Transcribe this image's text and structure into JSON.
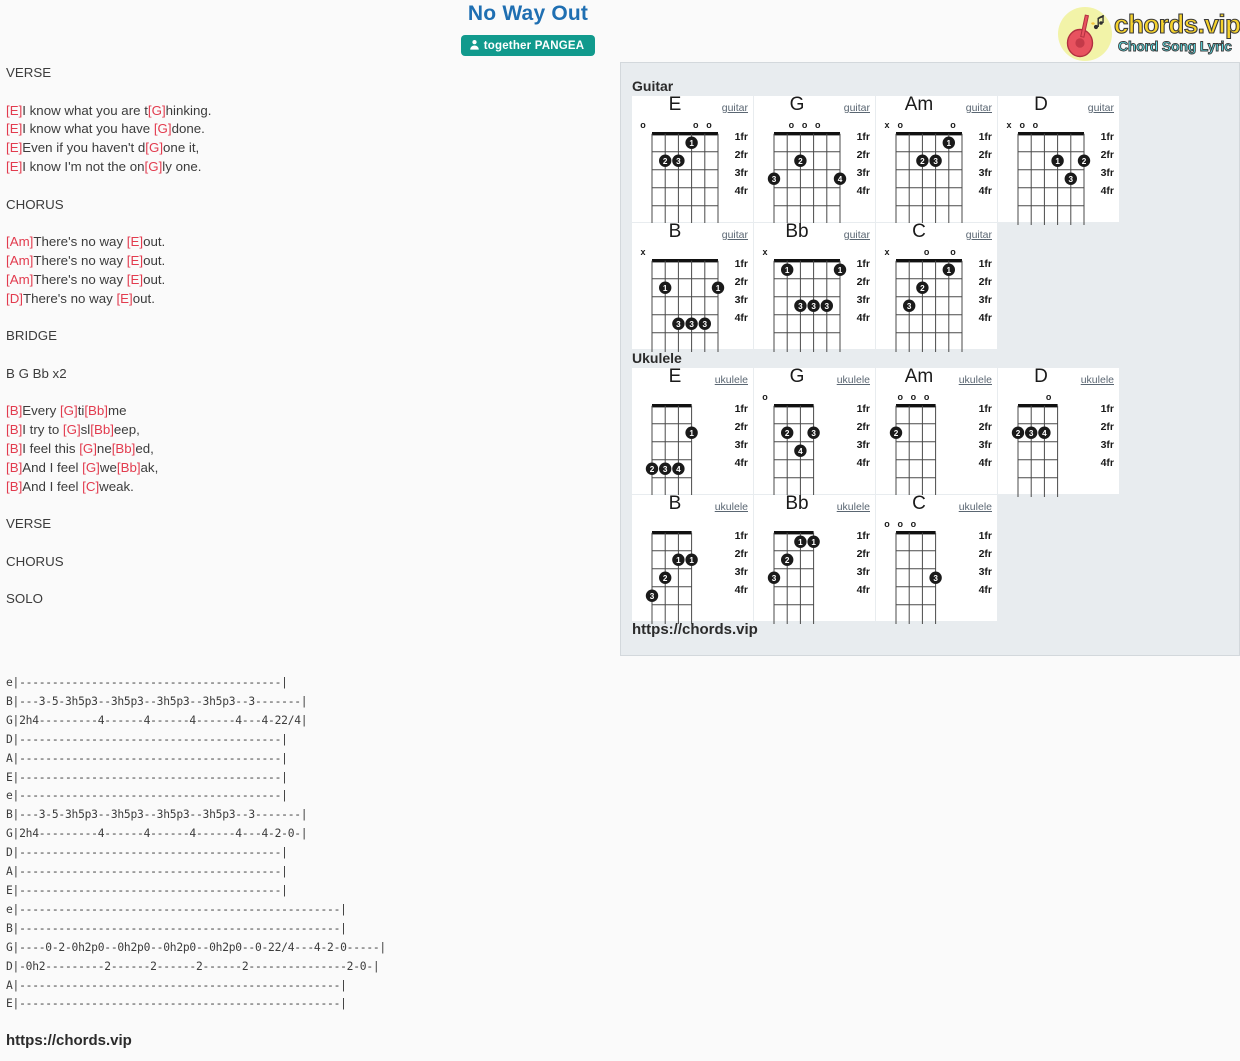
{
  "header": {
    "title": "No Way Out",
    "artist": "together PANGEA",
    "artist_icon": "user-icon",
    "logo_brand": "chords.vip",
    "logo_tagline": "Chord Song Lyric",
    "logo_icon": "guitar-logo-icon"
  },
  "lyrics": {
    "blocks": [
      {
        "type": "section",
        "text": "VERSE"
      },
      {
        "type": "blank",
        "text": ""
      },
      {
        "type": "line",
        "parts": [
          {
            "c": "[E]"
          },
          {
            "t": "I know what you are t"
          },
          {
            "c": "[G]"
          },
          {
            "t": "hinking."
          }
        ]
      },
      {
        "type": "line",
        "parts": [
          {
            "c": "[E]"
          },
          {
            "t": "I know what you have "
          },
          {
            "c": "[G]"
          },
          {
            "t": "done."
          }
        ]
      },
      {
        "type": "line",
        "parts": [
          {
            "c": "[E]"
          },
          {
            "t": "Even if you haven't d"
          },
          {
            "c": "[G]"
          },
          {
            "t": "one it,"
          }
        ]
      },
      {
        "type": "line",
        "parts": [
          {
            "c": "[E]"
          },
          {
            "t": "I know I'm not the on"
          },
          {
            "c": "[G]"
          },
          {
            "t": "ly one."
          }
        ]
      },
      {
        "type": "blank",
        "text": ""
      },
      {
        "type": "section",
        "text": "CHORUS"
      },
      {
        "type": "blank",
        "text": ""
      },
      {
        "type": "line",
        "parts": [
          {
            "c": "[Am]"
          },
          {
            "t": "There's no way "
          },
          {
            "c": "[E]"
          },
          {
            "t": "out."
          }
        ]
      },
      {
        "type": "line",
        "parts": [
          {
            "c": "[Am]"
          },
          {
            "t": "There's no way "
          },
          {
            "c": "[E]"
          },
          {
            "t": "out."
          }
        ]
      },
      {
        "type": "line",
        "parts": [
          {
            "c": "[Am]"
          },
          {
            "t": "There's no way "
          },
          {
            "c": "[E]"
          },
          {
            "t": "out."
          }
        ]
      },
      {
        "type": "line",
        "parts": [
          {
            "c": "[D]"
          },
          {
            "t": "There's no way "
          },
          {
            "c": "[E]"
          },
          {
            "t": "out."
          }
        ]
      },
      {
        "type": "blank",
        "text": ""
      },
      {
        "type": "section",
        "text": "BRIDGE"
      },
      {
        "type": "blank",
        "text": ""
      },
      {
        "type": "section",
        "text": "B G Bb x2"
      },
      {
        "type": "blank",
        "text": ""
      },
      {
        "type": "line",
        "parts": [
          {
            "c": "[B]"
          },
          {
            "t": "Every "
          },
          {
            "c": "[G]"
          },
          {
            "t": "ti"
          },
          {
            "c": "[Bb]"
          },
          {
            "t": "me"
          }
        ]
      },
      {
        "type": "line",
        "parts": [
          {
            "c": "[B]"
          },
          {
            "t": "I try to "
          },
          {
            "c": "[G]"
          },
          {
            "t": "sl"
          },
          {
            "c": "[Bb]"
          },
          {
            "t": "eep,"
          }
        ]
      },
      {
        "type": "line",
        "parts": [
          {
            "c": "[B]"
          },
          {
            "t": "I feel this "
          },
          {
            "c": "[G]"
          },
          {
            "t": "ne"
          },
          {
            "c": "[Bb]"
          },
          {
            "t": "ed,"
          }
        ]
      },
      {
        "type": "line",
        "parts": [
          {
            "c": "[B]"
          },
          {
            "t": "And I feel "
          },
          {
            "c": "[G]"
          },
          {
            "t": "we"
          },
          {
            "c": "[Bb]"
          },
          {
            "t": "ak,"
          }
        ]
      },
      {
        "type": "line",
        "parts": [
          {
            "c": "[B]"
          },
          {
            "t": "And I feel "
          },
          {
            "c": "[C]"
          },
          {
            "t": "weak."
          }
        ]
      },
      {
        "type": "blank",
        "text": ""
      },
      {
        "type": "section",
        "text": "VERSE"
      },
      {
        "type": "blank",
        "text": ""
      },
      {
        "type": "section",
        "text": "CHORUS"
      },
      {
        "type": "blank",
        "text": ""
      },
      {
        "type": "section",
        "text": "SOLO"
      }
    ]
  },
  "tab": {
    "lines": [
      "e|----------------------------------------|",
      "B|---3-5-3h5p3--3h5p3--3h5p3--3h5p3--3-------|",
      "G|2h4---------4------4------4------4---4-22/4|",
      "D|----------------------------------------|",
      "A|----------------------------------------|",
      "E|----------------------------------------|",
      "e|----------------------------------------|",
      "B|---3-5-3h5p3--3h5p3--3h5p3--3h5p3--3-------|",
      "G|2h4---------4------4------4------4---4-2-0-|",
      "D|----------------------------------------|",
      "A|----------------------------------------|",
      "E|----------------------------------------|",
      "e|-------------------------------------------------|",
      "B|-------------------------------------------------|",
      "G|----0-2-0h2p0--0h2p0--0h2p0--0h2p0--0-22/4---4-2-0-----|",
      "D|-0h2---------2------2------2------2---------------2-0-|",
      "A|-------------------------------------------------|",
      "E|-------------------------------------------------|"
    ]
  },
  "footer": {
    "left_url": "https://chords.vip",
    "panel_url": "https://chords.vip"
  },
  "panel": {
    "guitar_heading": "Guitar",
    "ukulele_heading": "Ukulele",
    "fret_labels": [
      "1fr",
      "2fr",
      "3fr",
      "4fr"
    ],
    "guitar_label": "guitar",
    "ukulele_label": "ukulele",
    "guitar_chords": [
      {
        "name": "E",
        "instrument": "guitar",
        "strings": 6,
        "open": [
          "o",
          "",
          "",
          "",
          "o",
          "o"
        ],
        "dots": [
          {
            "string": 3,
            "fret": 1,
            "finger": "1"
          },
          {
            "string": 5,
            "fret": 2,
            "finger": "2"
          },
          {
            "string": 4,
            "fret": 2,
            "finger": "3"
          }
        ]
      },
      {
        "name": "G",
        "instrument": "guitar",
        "strings": 6,
        "open": [
          "",
          "",
          "o",
          "o",
          "o",
          ""
        ],
        "dots": [
          {
            "string": 4,
            "fret": 2,
            "finger": "2"
          },
          {
            "string": 6,
            "fret": 3,
            "finger": "3"
          },
          {
            "string": 1,
            "fret": 3,
            "finger": "4"
          }
        ]
      },
      {
        "name": "Am",
        "instrument": "guitar",
        "strings": 6,
        "open": [
          "x",
          "o",
          "",
          "",
          "",
          "o"
        ],
        "dots": [
          {
            "string": 2,
            "fret": 1,
            "finger": "1"
          },
          {
            "string": 4,
            "fret": 2,
            "finger": "2"
          },
          {
            "string": 3,
            "fret": 2,
            "finger": "3"
          }
        ]
      },
      {
        "name": "D",
        "instrument": "guitar",
        "strings": 6,
        "open": [
          "x",
          "o",
          "o",
          "",
          "",
          ""
        ],
        "dots": [
          {
            "string": 3,
            "fret": 2,
            "finger": "1"
          },
          {
            "string": 1,
            "fret": 2,
            "finger": "2"
          },
          {
            "string": 2,
            "fret": 3,
            "finger": "3"
          }
        ]
      },
      {
        "name": "B",
        "instrument": "guitar",
        "strings": 6,
        "open": [
          "x",
          "",
          "",
          "",
          "",
          ""
        ],
        "dots": [
          {
            "string": 5,
            "fret": 2,
            "finger": "1"
          },
          {
            "string": 1,
            "fret": 2,
            "finger": "1"
          },
          {
            "string": 4,
            "fret": 4,
            "finger": "3"
          },
          {
            "string": 3,
            "fret": 4,
            "finger": "3"
          },
          {
            "string": 2,
            "fret": 4,
            "finger": "3"
          }
        ]
      },
      {
        "name": "Bb",
        "instrument": "guitar",
        "strings": 6,
        "open": [
          "x",
          "",
          "",
          "",
          "",
          ""
        ],
        "dots": [
          {
            "string": 5,
            "fret": 1,
            "finger": "1"
          },
          {
            "string": 1,
            "fret": 1,
            "finger": "1"
          },
          {
            "string": 4,
            "fret": 3,
            "finger": "3"
          },
          {
            "string": 3,
            "fret": 3,
            "finger": "3"
          },
          {
            "string": 2,
            "fret": 3,
            "finger": "3"
          }
        ]
      },
      {
        "name": "C",
        "instrument": "guitar",
        "strings": 6,
        "open": [
          "x",
          "",
          "",
          "o",
          "",
          "o"
        ],
        "dots": [
          {
            "string": 2,
            "fret": 1,
            "finger": "1"
          },
          {
            "string": 4,
            "fret": 2,
            "finger": "2"
          },
          {
            "string": 5,
            "fret": 3,
            "finger": "3"
          }
        ]
      }
    ],
    "ukulele_chords": [
      {
        "name": "E",
        "instrument": "ukulele",
        "strings": 4,
        "open": [
          "",
          "",
          "",
          ""
        ],
        "dots": [
          {
            "string": 1,
            "fret": 2,
            "finger": "1"
          },
          {
            "string": 4,
            "fret": 4,
            "finger": "2"
          },
          {
            "string": 3,
            "fret": 4,
            "finger": "3"
          },
          {
            "string": 2,
            "fret": 4,
            "finger": "4"
          }
        ]
      },
      {
        "name": "G",
        "instrument": "ukulele",
        "strings": 4,
        "open": [
          "o",
          "",
          "",
          ""
        ],
        "dots": [
          {
            "string": 3,
            "fret": 2,
            "finger": "2"
          },
          {
            "string": 1,
            "fret": 2,
            "finger": "3"
          },
          {
            "string": 2,
            "fret": 3,
            "finger": "4"
          }
        ]
      },
      {
        "name": "Am",
        "instrument": "ukulele",
        "strings": 4,
        "open": [
          "",
          "o",
          "o",
          "o"
        ],
        "dots": [
          {
            "string": 4,
            "fret": 2,
            "finger": "2"
          }
        ]
      },
      {
        "name": "D",
        "instrument": "ukulele",
        "strings": 4,
        "open": [
          "",
          "",
          "",
          "o"
        ],
        "dots": [
          {
            "string": 4,
            "fret": 2,
            "finger": "2"
          },
          {
            "string": 3,
            "fret": 2,
            "finger": "3"
          },
          {
            "string": 2,
            "fret": 2,
            "finger": "4"
          }
        ]
      },
      {
        "name": "B",
        "instrument": "ukulele",
        "strings": 4,
        "open": [
          "",
          "",
          "",
          ""
        ],
        "dots": [
          {
            "string": 2,
            "fret": 2,
            "finger": "1"
          },
          {
            "string": 1,
            "fret": 2,
            "finger": "1"
          },
          {
            "string": 3,
            "fret": 3,
            "finger": "2"
          },
          {
            "string": 4,
            "fret": 4,
            "finger": "3"
          }
        ]
      },
      {
        "name": "Bb",
        "instrument": "ukulele",
        "strings": 4,
        "open": [
          "",
          "",
          "",
          ""
        ],
        "dots": [
          {
            "string": 2,
            "fret": 1,
            "finger": "1"
          },
          {
            "string": 1,
            "fret": 1,
            "finger": "1"
          },
          {
            "string": 3,
            "fret": 2,
            "finger": "2"
          },
          {
            "string": 4,
            "fret": 3,
            "finger": "3"
          }
        ]
      },
      {
        "name": "C",
        "instrument": "ukulele",
        "strings": 4,
        "open": [
          "o",
          "o",
          "o",
          ""
        ],
        "dots": [
          {
            "string": 1,
            "fret": 3,
            "finger": "3"
          }
        ]
      }
    ]
  },
  "colors": {
    "title_blue": "#1f6fb2",
    "badge_teal": "#119a8d",
    "chord_red": "#e23b4e",
    "panel_bg": "#e8ecef",
    "text": "#3c3c3c"
  }
}
